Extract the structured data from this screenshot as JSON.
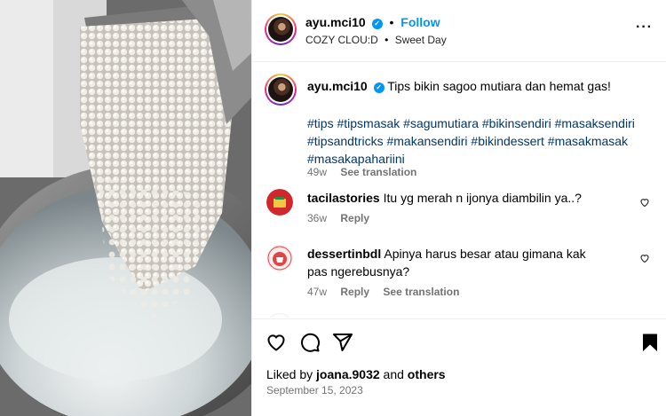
{
  "post": {
    "username": "ayu.mci10",
    "follow_label": "Follow",
    "location": "COZY CLOU:D",
    "audio": "Sweet Day",
    "caption": "Tips bikin sagoo mutiara dan hemat gas!",
    "hashtags": "#tips #tipsmasak #sagumutiara #bikinsendiri #masaksendiri #tipsandtricks #makansendiri #bikindessert #masakmasak #masakapahariini",
    "age": "49w",
    "see_translation": "See translation"
  },
  "comments": [
    {
      "username": "tacilastories",
      "text": "Itu yg merah n ijonya diambilin ya..?",
      "age": "36w",
      "reply_label": "Reply"
    },
    {
      "username": "dessertinbdl",
      "text": "Apinya harus besar atau gimana kak pas ngerebusnya?",
      "age": "47w",
      "reply_label": "Reply",
      "see_translation": "See translation"
    }
  ],
  "footer": {
    "liked_by_prefix": "Liked by",
    "liked_by_user": "joana.9032",
    "liked_and": "and",
    "liked_others": "others",
    "date": "September 15, 2023"
  },
  "icons": {
    "verified": "verified-badge",
    "more": "more-options-icon",
    "like": "heart-icon",
    "comment": "comment-icon",
    "share": "share-icon",
    "save": "bookmark-icon"
  },
  "colors": {
    "accent": "#0095f6",
    "hashtag": "#00376b",
    "muted": "#737373",
    "divider": "#efefef"
  }
}
